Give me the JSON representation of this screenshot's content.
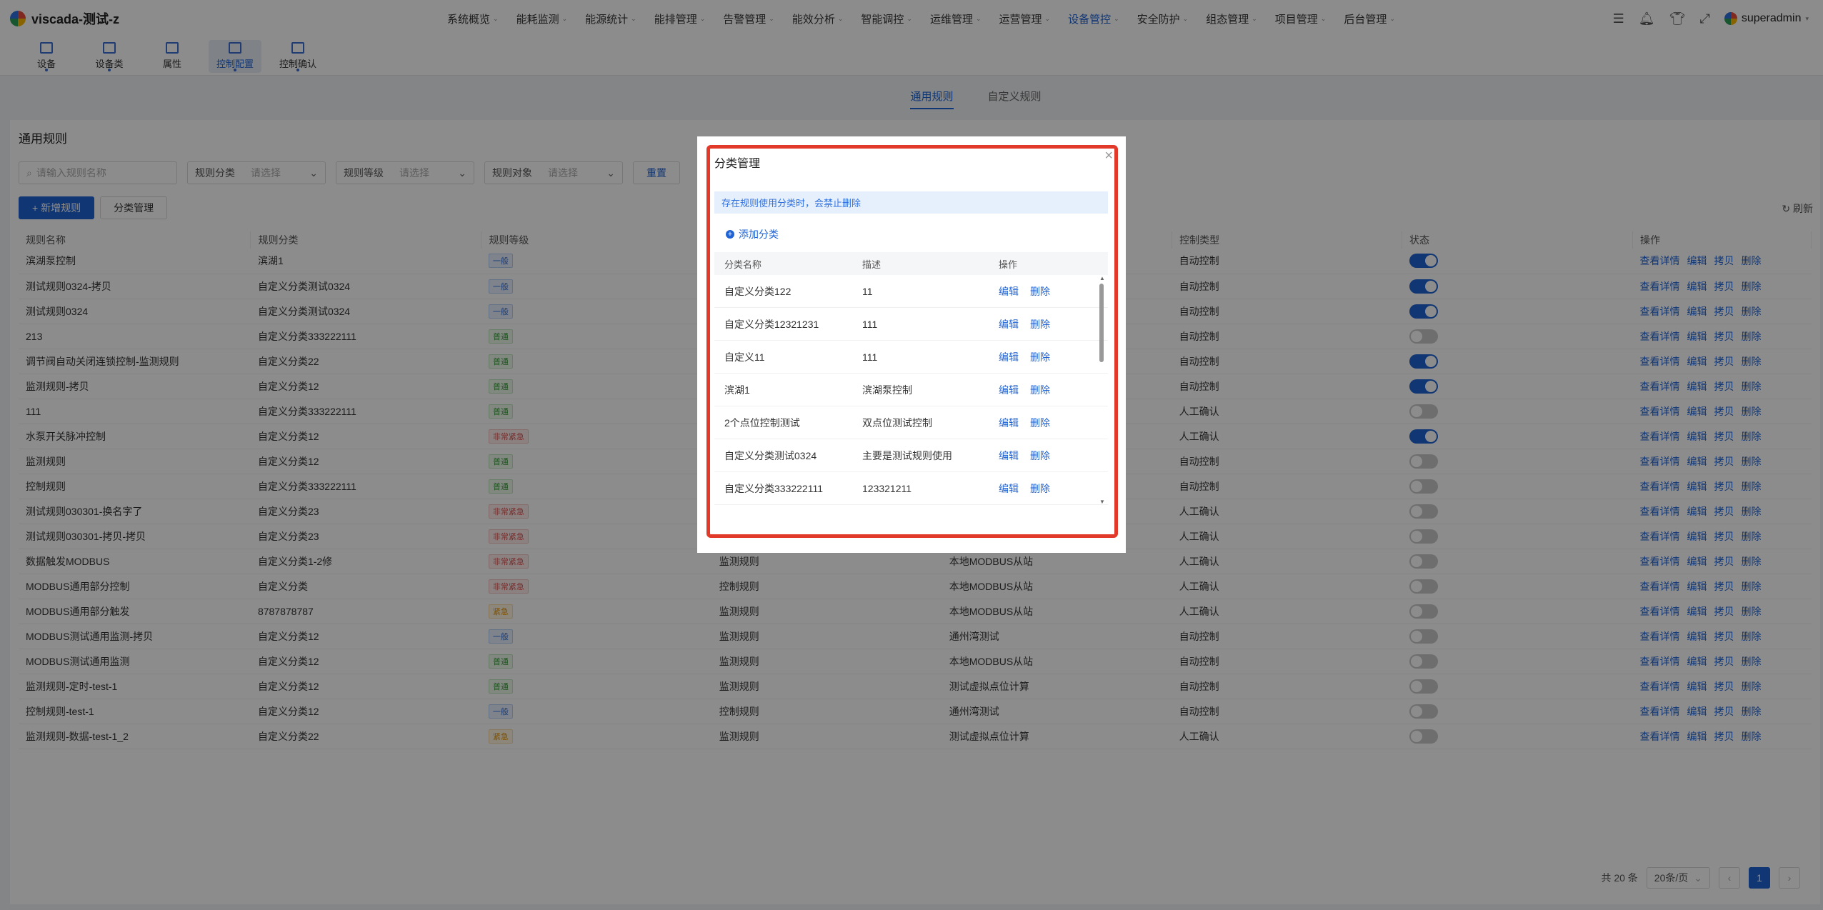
{
  "app": {
    "title": "viscada-测试-z"
  },
  "nav": [
    "系统概览",
    "能耗监测",
    "能源统计",
    "能排管理",
    "告警管理",
    "能效分析",
    "智能调控",
    "运维管理",
    "运营管理",
    "设备管控",
    "安全防护",
    "组态管理",
    "项目管理",
    "后台管理"
  ],
  "nav_active": 9,
  "user": {
    "name": "superadmin"
  },
  "subnav": [
    "设备",
    "设备类",
    "属性",
    "控制配置",
    "控制确认"
  ],
  "subnav_active": 3,
  "tabs": [
    "通用规则",
    "自定义规则"
  ],
  "panel_title": "通用规则",
  "filters": {
    "search_placeholder": "请输入规则名称",
    "category_label": "规则分类",
    "category_placeholder": "请选择",
    "level_label": "规则等级",
    "level_placeholder": "请选择",
    "target_label": "规则对象",
    "target_placeholder": "请选择",
    "reset": "重置"
  },
  "actions": {
    "add_rule": "+ 新增规则",
    "category_manage": "分类管理",
    "refresh": "刷新"
  },
  "table": {
    "headers": [
      "规则名称",
      "规则分类",
      "规则等级",
      "",
      "",
      "控制类型",
      "状态",
      "操作"
    ],
    "row_actions": [
      "查看详情",
      "编辑",
      "拷贝",
      "删除"
    ],
    "rows": [
      {
        "name": "滨湖泵控制",
        "cat": "滨湖1",
        "level": "一般",
        "tone": "blue",
        "c4": "",
        "c5": "",
        "ctype": "自动控制",
        "on": true
      },
      {
        "name": "测试规则0324-拷贝",
        "cat": "自定义分类测试0324",
        "level": "一般",
        "tone": "blue",
        "c4": "",
        "c5": "",
        "ctype": "自动控制",
        "on": true
      },
      {
        "name": "测试规则0324",
        "cat": "自定义分类测试0324",
        "level": "一般",
        "tone": "blue",
        "c4": "",
        "c5": "",
        "ctype": "自动控制",
        "on": true
      },
      {
        "name": "213",
        "cat": "自定义分类333222111",
        "level": "普通",
        "tone": "green",
        "c4": "",
        "c5": "",
        "ctype": "自动控制",
        "on": false
      },
      {
        "name": "调节阀自动关闭连锁控制-监测规则",
        "cat": "自定义分类22",
        "level": "普通",
        "tone": "green",
        "c4": "",
        "c5": "",
        "ctype": "自动控制",
        "on": true
      },
      {
        "name": "监测规则-拷贝",
        "cat": "自定义分类12",
        "level": "普通",
        "tone": "green",
        "c4": "",
        "c5": "",
        "ctype": "自动控制",
        "on": true
      },
      {
        "name": "111",
        "cat": "自定义分类333222111",
        "level": "普通",
        "tone": "green",
        "c4": "",
        "c5": "",
        "ctype": "人工确认",
        "on": false
      },
      {
        "name": "水泵开关脉冲控制",
        "cat": "自定义分类12",
        "level": "非常紧急",
        "tone": "red",
        "c4": "",
        "c5": "",
        "ctype": "人工确认",
        "on": true
      },
      {
        "name": "监测规则",
        "cat": "自定义分类12",
        "level": "普通",
        "tone": "green",
        "c4": "",
        "c5": "",
        "ctype": "自动控制",
        "on": false
      },
      {
        "name": "控制规则",
        "cat": "自定义分类333222111",
        "level": "普通",
        "tone": "green",
        "c4": "",
        "c5": "",
        "ctype": "自动控制",
        "on": false
      },
      {
        "name": "测试规则030301-换名字了",
        "cat": "自定义分类23",
        "level": "非常紧急",
        "tone": "red",
        "c4": "",
        "c5": "",
        "ctype": "人工确认",
        "on": false
      },
      {
        "name": "测试规则030301-拷贝-拷贝",
        "cat": "自定义分类23",
        "level": "非常紧急",
        "tone": "red",
        "c4": "",
        "c5": "",
        "ctype": "人工确认",
        "on": false
      },
      {
        "name": "数据触发MODBUS",
        "cat": "自定义分类1-2修",
        "level": "非常紧急",
        "tone": "red",
        "c4": "监测规则",
        "c5": "本地MODBUS从站",
        "ctype": "人工确认",
        "on": false
      },
      {
        "name": "MODBUS通用部分控制",
        "cat": "自定义分类",
        "level": "非常紧急",
        "tone": "red",
        "c4": "控制规则",
        "c5": "本地MODBUS从站",
        "ctype": "人工确认",
        "on": false
      },
      {
        "name": "MODBUS通用部分触发",
        "cat": "8787878787",
        "level": "紧急",
        "tone": "orange",
        "c4": "监测规则",
        "c5": "本地MODBUS从站",
        "ctype": "人工确认",
        "on": false
      },
      {
        "name": "MODBUS测试通用监测-拷贝",
        "cat": "自定义分类12",
        "level": "一般",
        "tone": "blue",
        "c4": "监测规则",
        "c5": "通州湾测试",
        "ctype": "自动控制",
        "on": false
      },
      {
        "name": "MODBUS测试通用监测",
        "cat": "自定义分类12",
        "level": "普通",
        "tone": "green",
        "c4": "监测规则",
        "c5": "本地MODBUS从站",
        "ctype": "自动控制",
        "on": false
      },
      {
        "name": "监测规则-定时-test-1",
        "cat": "自定义分类12",
        "level": "普通",
        "tone": "green",
        "c4": "监测规则",
        "c5": "测试虚拟点位计算",
        "ctype": "自动控制",
        "on": false
      },
      {
        "name": "控制规则-test-1",
        "cat": "自定义分类12",
        "level": "一般",
        "tone": "blue",
        "c4": "控制规则",
        "c5": "通州湾测试",
        "ctype": "自动控制",
        "on": false
      },
      {
        "name": "监测规则-数据-test-1_2",
        "cat": "自定义分类22",
        "level": "紧急",
        "tone": "orange",
        "c4": "监测规则",
        "c5": "测试虚拟点位计算",
        "ctype": "人工确认",
        "on": false
      }
    ]
  },
  "pager": {
    "total": "共 20 条",
    "size": "20条/页",
    "page": "1"
  },
  "modal": {
    "title": "分类管理",
    "alert": "存在规则使用分类时，会禁止删除",
    "add": "添加分类",
    "headers": [
      "分类名称",
      "描述",
      "操作"
    ],
    "edit": "编辑",
    "del": "删除",
    "rows": [
      {
        "name": "自定义分类122",
        "desc": "11"
      },
      {
        "name": "自定义分类12321231",
        "desc": "111"
      },
      {
        "name": "自定义11",
        "desc": "111"
      },
      {
        "name": "滨湖1",
        "desc": "滨湖泵控制"
      },
      {
        "name": "2个点位控制测试",
        "desc": "双点位测试控制"
      },
      {
        "name": "自定义分类测试0324",
        "desc": "主要是测试规则使用"
      },
      {
        "name": "自定义分类333222111",
        "desc": "123321211"
      }
    ]
  }
}
